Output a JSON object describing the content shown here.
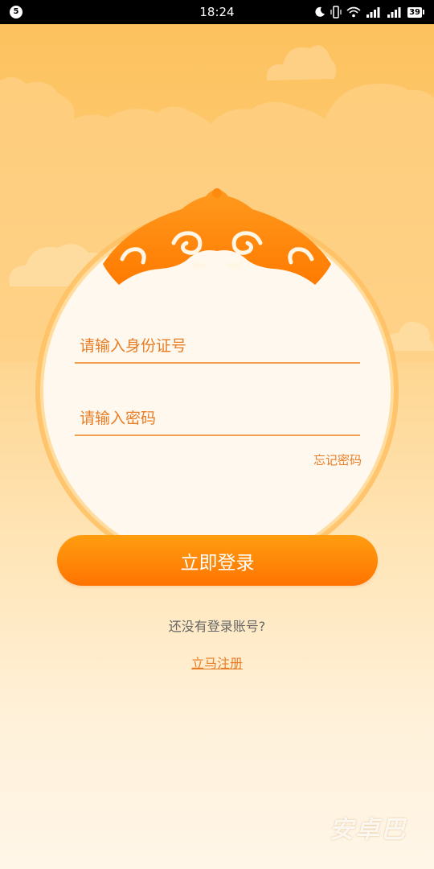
{
  "status_bar": {
    "notification_count": "5",
    "time": "18:24",
    "battery": "39"
  },
  "login": {
    "id_placeholder": "请输入身份证号",
    "password_placeholder": "请输入密码",
    "forgot_password": "忘记密码",
    "submit_label": "立即登录",
    "no_account_prompt": "还没有登录账号?",
    "register_link": "立马注册"
  },
  "watermark": {
    "logo_text": "安卓巴"
  },
  "colors": {
    "accent": "#e87d24",
    "button": "#ff8708",
    "background_top": "#fdc05c",
    "background_bottom": "#fff6e8"
  }
}
